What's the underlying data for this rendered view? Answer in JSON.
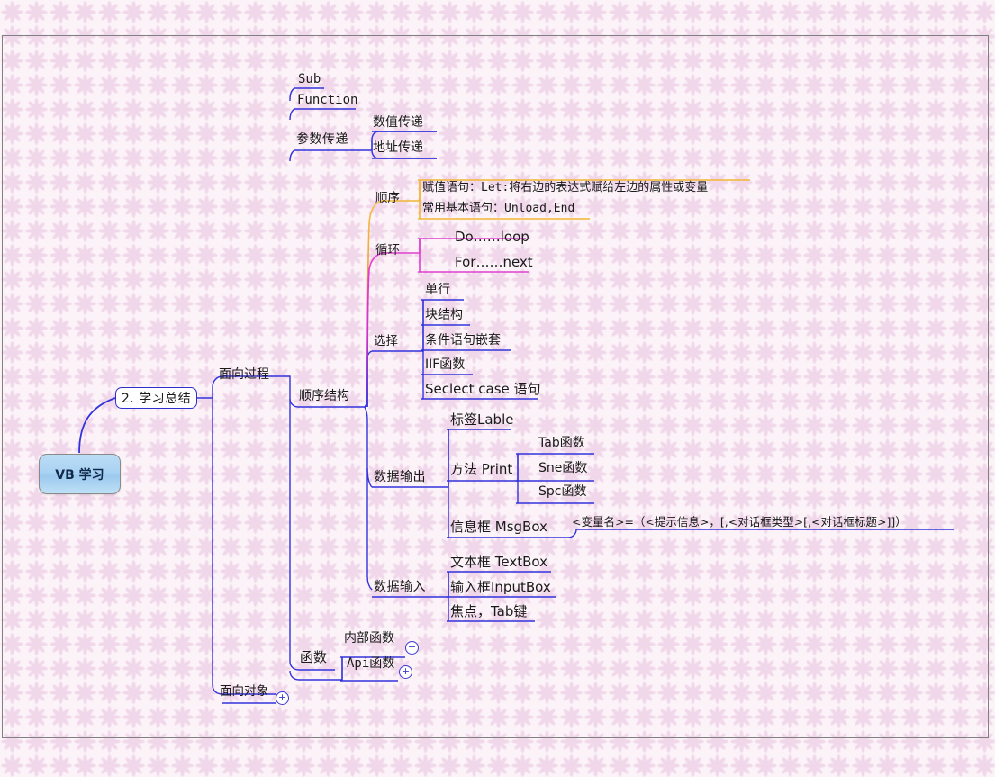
{
  "document": {
    "title": "VB 学习",
    "type": "mindmap"
  },
  "root": {
    "label": "VB 学习",
    "fill_top": "#bcddf5",
    "fill_bottom": "#bfe0f7",
    "border": "#8a8a8a"
  },
  "level1": {
    "label": "2. 学习总结",
    "border": "#2f2fd0"
  },
  "branches": {
    "process_oriented": "面向过程",
    "object_oriented": "面向对象"
  },
  "topics": {
    "sub": "Sub",
    "function_kw": "Function",
    "param_pass": "参数传递",
    "param_value": "数值传递",
    "param_address": "地址传递",
    "sequence_struct": "顺序结构",
    "order": "顺序",
    "order_assign": "赋值语句：Let:将右边的表达式赋给左边的属性或变量",
    "order_basic": "常用基本语句：Unload,End",
    "loop": "循环",
    "loop_do": "Do……loop",
    "loop_for": "For……next",
    "select": "选择",
    "select_single": "单行",
    "select_block": "块结构",
    "select_nest": "条件语句嵌套",
    "select_iif": "IIF函数",
    "select_case": "Seclect case 语句",
    "data_output": "数据输出",
    "out_label": "标签Lable",
    "out_print": "方法 Print",
    "out_tab": "Tab函数",
    "out_sne": "Sne函数",
    "out_spc": "Spc函数",
    "out_msgbox": "信息框 MsgBox",
    "out_msgbox_syntax": "<变量名>=（<提示信息>，[,<对话框类型>[,<对话框标题>]]）",
    "data_input": "数据输入",
    "in_textbox": "文本框 TextBox",
    "in_inputbox": "输入框InputBox",
    "in_focus": "焦点，Tab键",
    "functions": "函数",
    "fn_internal": "内部函数",
    "fn_api": "Api函数"
  },
  "expanders": {
    "symbol": "+"
  },
  "colors": {
    "line_blue": "#3333dd",
    "line_orange": "#f2b632",
    "line_magenta": "#e040d0",
    "background": "#fcf3f8",
    "flower": "#f0d4e8",
    "frame_border": "#808080"
  }
}
